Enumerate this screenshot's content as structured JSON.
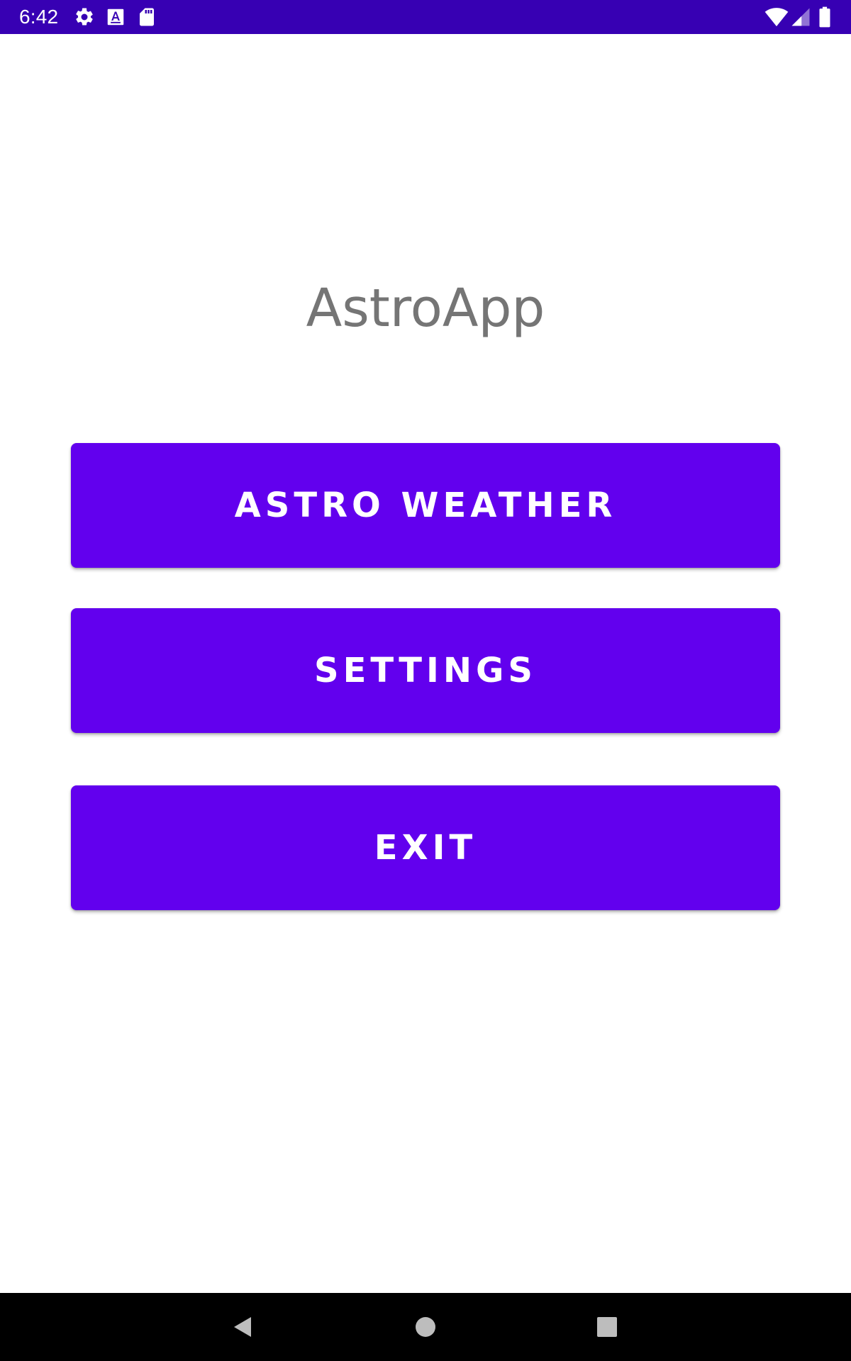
{
  "status_bar": {
    "time": "6:42",
    "icons": [
      "gear-icon",
      "font-a-icon",
      "sd-card-icon",
      "wifi-icon",
      "signal-icon",
      "battery-icon"
    ],
    "background": "#3700b3"
  },
  "app": {
    "title": "AstroApp"
  },
  "menu": {
    "astro_weather_label": "ASTRO WEATHER",
    "settings_label": "SETTINGS",
    "exit_label": "EXIT",
    "button_color": "#6200ee"
  },
  "nav_bar": {
    "icons": [
      "back-icon",
      "home-icon",
      "recents-icon"
    ]
  }
}
